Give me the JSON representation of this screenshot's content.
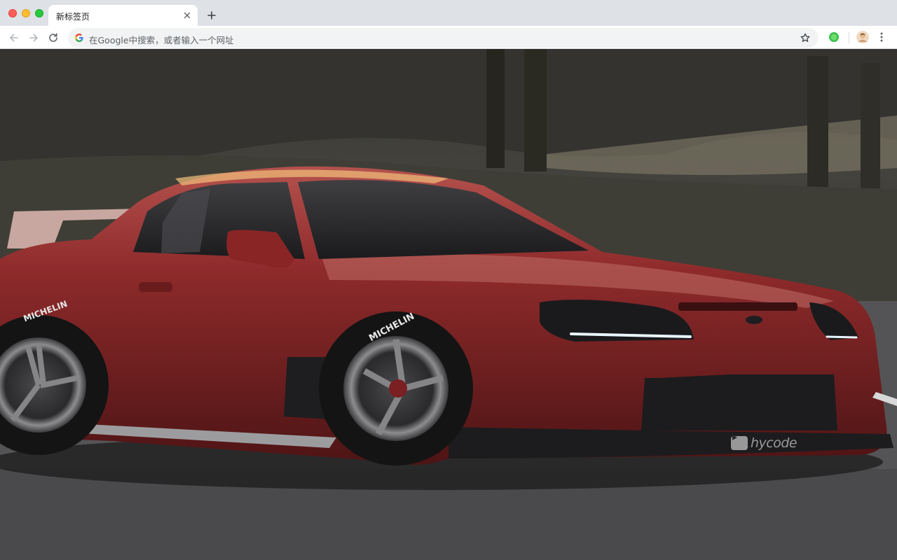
{
  "browser": {
    "tab": {
      "title": "新标签页"
    },
    "omnibox": {
      "placeholder": "在Google中搜索，或者输入一个网址"
    }
  },
  "wallpaper": {
    "watermark": "hycode",
    "tire_brand": "MICHELIN",
    "car_color": "#8e2a2b"
  },
  "icons": {
    "close": "close-icon",
    "new_tab": "plus-icon",
    "back": "back-arrow-icon",
    "forward": "forward-arrow-icon",
    "reload": "reload-icon",
    "google": "google-g-icon",
    "bookmark": "star-icon",
    "extension": "green-circle-extension-icon",
    "profile": "profile-avatar-icon",
    "menu": "vertical-dots-menu-icon"
  }
}
